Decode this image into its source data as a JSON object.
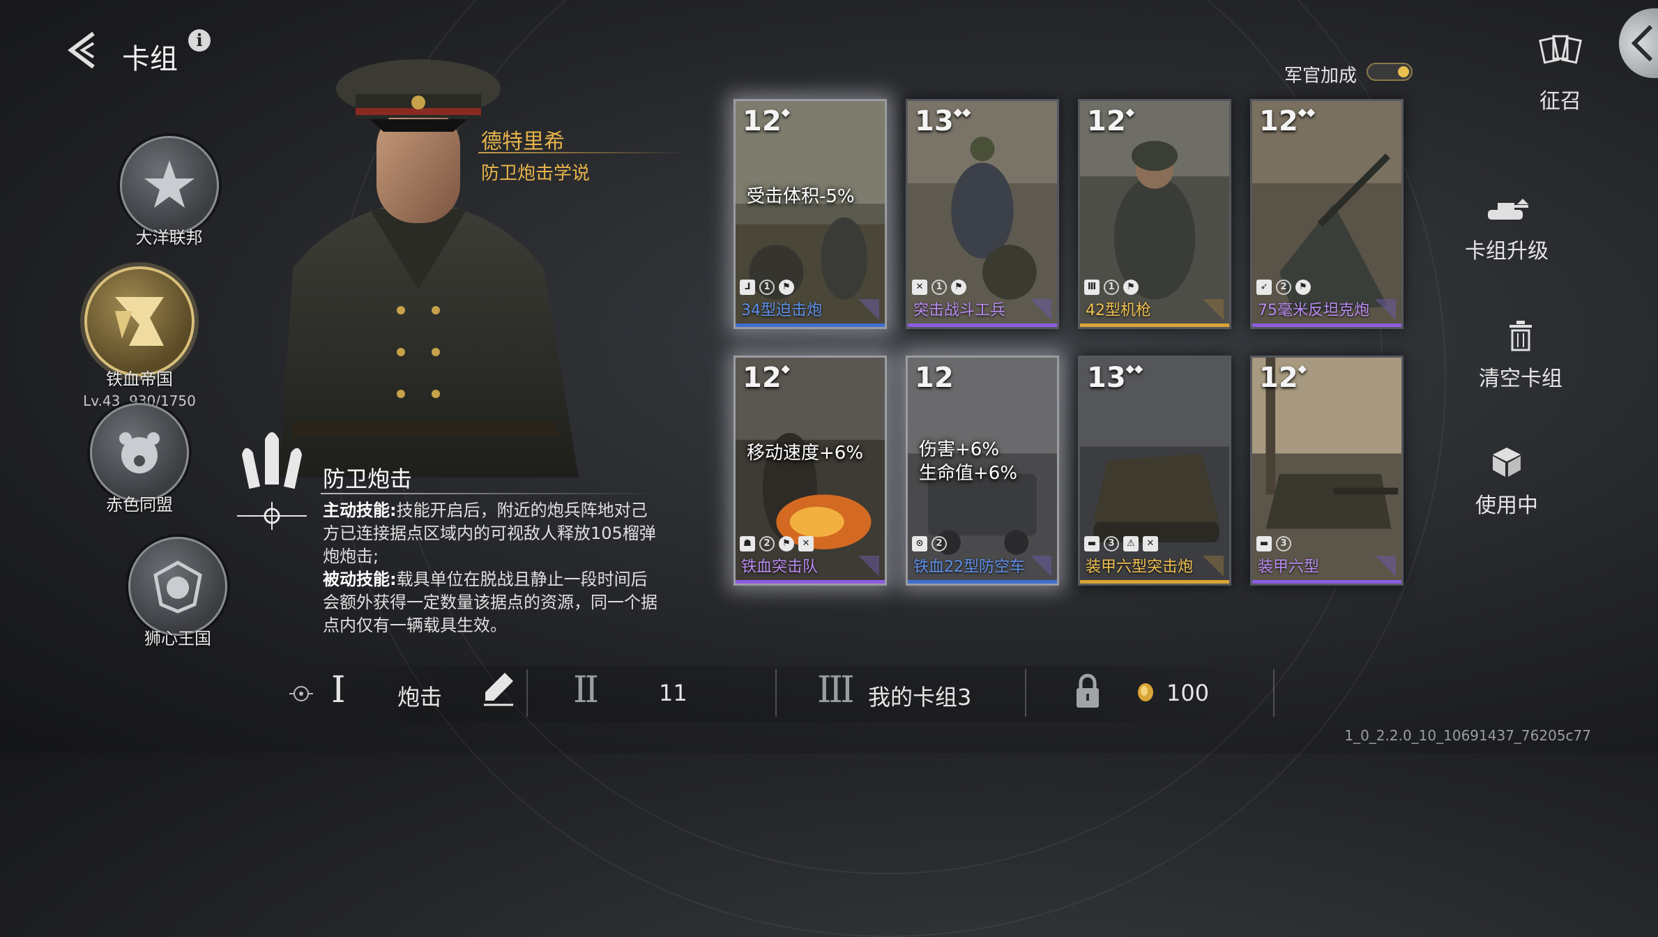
{
  "header": {
    "title": "卡组",
    "back_icon": "chevron-left-icon",
    "info_icon": "info-icon"
  },
  "factions": [
    {
      "name": "大洋联邦",
      "icon": "star-eagle-emblem"
    },
    {
      "name": "铁血帝国",
      "icon": "lion-emblem",
      "active": true,
      "level": "Lv.43",
      "exp": "930/1750"
    },
    {
      "name": "赤色同盟",
      "icon": "bear-emblem"
    },
    {
      "name": "狮心王国",
      "icon": "lion-head-emblem"
    }
  ],
  "commander": {
    "name": "德特里希",
    "doctrine": "防卫炮击学说"
  },
  "skill": {
    "title": "防卫炮击",
    "active_label": "主动技能:",
    "active_text": "技能开启后，附近的炮兵阵地对己方已连接据点区域内的可视敌人释放105榴弹炮炮击;",
    "passive_label": "被动技能:",
    "passive_text": "载具单位在脱战且静止一段时间后会额外获得一定数量该据点的资源，同一个据点内仅有一辆载具生效。"
  },
  "cards": [
    {
      "cost": "12",
      "name": "34型迫击炮",
      "rarity": "blue",
      "buff": [
        "受击体积-5%"
      ],
      "level": "1"
    },
    {
      "cost": "13",
      "name": "突击战斗工兵",
      "rarity": "purple",
      "buff": [],
      "level": "1"
    },
    {
      "cost": "12",
      "name": "42型机枪",
      "rarity": "gold",
      "buff": [],
      "level": "1"
    },
    {
      "cost": "12",
      "name": "75毫米反坦克炮",
      "rarity": "purple",
      "buff": [],
      "level": "2"
    },
    {
      "cost": "12",
      "name": "铁血突击队",
      "rarity": "purple",
      "buff": [
        "移动速度+6%"
      ],
      "level": "2"
    },
    {
      "cost": "12",
      "name": "铁血22型防空车",
      "rarity": "blue",
      "buff": [
        "伤害+6%",
        "生命值+6%"
      ],
      "level": "2"
    },
    {
      "cost": "13",
      "name": "装甲六型突击炮",
      "rarity": "gold",
      "buff": [],
      "level": "3"
    },
    {
      "cost": "12",
      "name": "装甲六型",
      "rarity": "purple",
      "buff": [],
      "level": "3"
    }
  ],
  "right_panel": {
    "officer_bonus_label": "军官加成",
    "recruit_label": "征召",
    "upgrade_label": "卡组升级",
    "clear_label": "清空卡组",
    "in_use_label": "使用中"
  },
  "bottom_bar": {
    "slot1_numeral": "I",
    "slot1_label": "炮击",
    "slot2_numeral": "II",
    "slot2_value": "11",
    "slot3_numeral": "III",
    "slot3_label": "我的卡组3",
    "cost_value": "100"
  },
  "version": "1_0_2.2.0_10_10691437_76205c77",
  "colors": {
    "accent_gold": "#e8b44a",
    "rarity_blue": "#3f6fd0",
    "rarity_purple": "#8c5ce0",
    "rarity_gold": "#d9a436"
  }
}
